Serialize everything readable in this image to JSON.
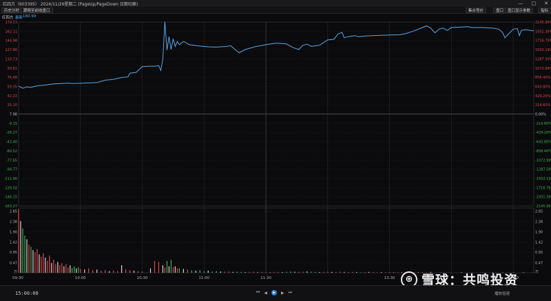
{
  "window": {
    "title": "红四方（603395） 2024/11/26星期二  (PageUp/PageDown 日期切换)",
    "minimize": "—",
    "maximize": "□",
    "close": "✕"
  },
  "toolbar": {
    "history_btn": "历史分时",
    "follow_btn": "跟随至前收盘口",
    "auction_btn": "集合竞价",
    "orderbook_btn": "盘口",
    "orderbook_params_btn": "盘口显示参数",
    "indicator_btn": "指标"
  },
  "info": {
    "stock_name": "红四方",
    "latest_label": "最新",
    "latest_value": "160.99"
  },
  "colors": {
    "up": "#e0484e",
    "down": "#3db24f",
    "line": "#5aa7e8",
    "grid": "#2a2a2e",
    "axis_text": "#b0b0b0"
  },
  "chart_data": [
    {
      "type": "line",
      "name": "price",
      "x_ticks": [
        "09:30",
        "10:00",
        "10:30",
        "11:00",
        "11:30",
        "13:30",
        "14:30"
      ],
      "price_levels": [
        "179.23",
        "162.11",
        "144.98",
        "127.86",
        "110.73",
        "93.61",
        "76.48",
        "59.35",
        "42.23",
        "25.10",
        "7.98",
        "-9.15",
        "-26.27",
        "-43.40",
        "-60.52",
        "-77.65",
        "-94.77",
        "-111.90",
        "-129.02",
        "-146.15",
        "-163.27"
      ],
      "pct_levels": [
        "2145.99%",
        "1931.39%",
        "1716.79%",
        "1502.19%",
        "1287.59%",
        "1072.99%",
        "858.40%",
        "643.80%",
        "429.20%",
        "214.60%",
        "0.00%",
        "-214.60%",
        "-429.20%",
        "-643.80%",
        "-858.40%",
        "-1072.99%",
        "-1287.59%",
        "-1502.19%",
        "-1716.79%",
        "-1931.39%",
        "-2145.99%"
      ],
      "ylim": [
        -163.27,
        179.23
      ],
      "prev_close": 7.98,
      "points": [
        [
          0,
          60.0
        ],
        [
          2,
          56.0
        ],
        [
          4,
          58.5
        ],
        [
          6,
          57.5
        ],
        [
          8,
          59.5
        ],
        [
          10,
          61.0
        ],
        [
          12,
          61.5
        ],
        [
          14,
          62.5
        ],
        [
          17,
          64.0
        ],
        [
          20,
          64.5
        ],
        [
          24,
          65.5
        ],
        [
          26,
          64.8
        ],
        [
          30,
          65.2
        ],
        [
          38,
          66.5
        ],
        [
          42,
          71.0
        ],
        [
          46,
          72.5
        ],
        [
          50,
          76.0
        ],
        [
          53,
          77.0
        ],
        [
          54,
          84.0
        ],
        [
          57,
          85.5
        ],
        [
          60,
          96.0
        ],
        [
          63,
          97.0
        ],
        [
          66,
          97.0
        ],
        [
          68,
          98.0
        ],
        [
          69,
          89.0
        ],
        [
          70,
          110.0
        ],
        [
          71,
          180.0
        ],
        [
          72,
          127.0
        ],
        [
          73,
          152.0
        ],
        [
          74,
          128.0
        ],
        [
          75,
          148.0
        ],
        [
          76,
          134.0
        ],
        [
          77,
          143.0
        ],
        [
          78,
          137.0
        ],
        [
          80,
          143.0
        ],
        [
          83,
          137.0
        ],
        [
          86,
          135.5
        ],
        [
          88,
          134.5
        ],
        [
          92,
          133.0
        ],
        [
          96,
          132.5
        ],
        [
          100,
          133.5
        ],
        [
          103,
          135.0
        ],
        [
          105,
          128.0
        ],
        [
          107,
          122.0
        ],
        [
          110,
          128.0
        ],
        [
          115,
          133.5
        ],
        [
          120,
          137.0
        ],
        [
          125,
          140.0
        ],
        [
          130,
          138.5
        ],
        [
          133,
          132.0
        ],
        [
          136,
          128.0
        ],
        [
          138,
          136.0
        ],
        [
          140,
          138.0
        ],
        [
          142,
          134.0
        ],
        [
          146,
          136.0
        ],
        [
          150,
          146.0
        ],
        [
          153,
          147.0
        ],
        [
          155,
          157.0
        ],
        [
          157,
          160.0
        ],
        [
          158,
          150.0
        ],
        [
          160,
          152.0
        ],
        [
          163,
          154.0
        ],
        [
          165,
          152.0
        ],
        [
          168,
          153.0
        ],
        [
          172,
          154.0
        ],
        [
          176,
          154.5
        ],
        [
          180,
          155.0
        ],
        [
          185,
          155.5
        ],
        [
          188,
          158.0
        ],
        [
          192,
          163.0
        ],
        [
          196,
          169.0
        ],
        [
          198,
          172.0
        ],
        [
          200,
          168.0
        ],
        [
          202,
          159.0
        ],
        [
          204,
          166.0
        ],
        [
          206,
          168.0
        ],
        [
          208,
          163.5
        ],
        [
          210,
          169.0
        ],
        [
          215,
          170.0
        ],
        [
          218,
          170.5
        ],
        [
          220,
          169.0
        ],
        [
          225,
          169.0
        ],
        [
          230,
          168.0
        ],
        [
          233,
          166.0
        ],
        [
          235,
          159.0
        ],
        [
          236,
          150.0
        ],
        [
          238,
          158.0
        ],
        [
          240,
          166.0
        ],
        [
          242,
          167.0
        ],
        [
          243,
          154.0
        ],
        [
          244,
          164.0
        ],
        [
          246,
          165.0
        ],
        [
          250,
          163.0
        ]
      ]
    },
    {
      "type": "bar",
      "name": "volume",
      "unit": "万",
      "y_ticks": [
        "2.85",
        "2.38",
        "1.90",
        "1.42",
        "0.95",
        "0.47"
      ],
      "ylim": [
        0,
        3.0
      ],
      "x": [
        0,
        1,
        2,
        3,
        4,
        5,
        6,
        7,
        8,
        9,
        10,
        11,
        12,
        13,
        14,
        15,
        16,
        17,
        18,
        19,
        20,
        21,
        22,
        23,
        24,
        25,
        26,
        27,
        28,
        29,
        30,
        32,
        34,
        36,
        38,
        40,
        42,
        44,
        46,
        48,
        50,
        52,
        54,
        56,
        58,
        60,
        64,
        66,
        68,
        70,
        71,
        72,
        73,
        74,
        75,
        76,
        77,
        78,
        80,
        82,
        84,
        86,
        88,
        90,
        92,
        94,
        96,
        98,
        100,
        102,
        104,
        106,
        108,
        110,
        112,
        114,
        116,
        118,
        120,
        122,
        124,
        126,
        128,
        130,
        132,
        134,
        136,
        138,
        140,
        142,
        144,
        146,
        148,
        150,
        152,
        154,
        156,
        158,
        160,
        162,
        164,
        166,
        168,
        170,
        172,
        174,
        176,
        178,
        180,
        182,
        184,
        186,
        188,
        190,
        192,
        194,
        196,
        198,
        200,
        205,
        210,
        215,
        220,
        225,
        230,
        235,
        240,
        245,
        250
      ],
      "values": [
        2.95,
        2.4,
        2.05,
        1.72,
        1.55,
        1.3,
        1.2,
        1.05,
        0.95,
        1.1,
        0.85,
        0.75,
        0.9,
        0.7,
        0.55,
        0.8,
        0.45,
        0.6,
        0.4,
        0.5,
        0.35,
        0.45,
        0.3,
        0.4,
        0.25,
        0.35,
        0.22,
        0.3,
        0.2,
        0.25,
        0.18,
        0.15,
        0.2,
        0.12,
        0.15,
        0.1,
        0.12,
        0.08,
        0.1,
        0.08,
        0.35,
        0.15,
        0.12,
        0.1,
        0.08,
        0.06,
        0.2,
        0.55,
        0.5,
        0.35,
        0.25,
        0.55,
        0.3,
        0.6,
        0.25,
        0.3,
        0.2,
        0.22,
        0.18,
        0.15,
        0.12,
        0.1,
        0.12,
        0.08,
        0.1,
        0.06,
        0.08,
        0.06,
        0.05,
        0.06,
        0.04,
        0.05,
        0.04,
        0.03,
        0.04,
        0.05,
        0.03,
        0.04,
        0.03,
        0.02,
        0.03,
        0.04,
        0.03,
        0.05,
        0.06,
        0.05,
        0.04,
        0.05,
        0.06,
        0.05,
        0.04,
        0.03,
        0.04,
        0.05,
        0.04,
        0.03,
        0.05,
        0.04,
        0.03,
        0.04,
        0.03,
        0.02,
        0.03,
        0.04,
        0.03,
        0.02,
        0.03,
        0.02,
        0.03,
        0.02,
        0.02,
        0.03,
        0.02,
        0.03,
        0.02,
        0.02,
        0.03,
        0.02,
        0.04,
        0.02,
        0.02,
        0.02,
        0.02,
        0.02,
        0.02,
        0.02,
        0.02,
        0.02,
        0.02
      ]
    }
  ],
  "bottom": {
    "time": "15:00:00",
    "speed_label": "播放倍速",
    "ctrl_first": "⏮",
    "ctrl_prev": "◀",
    "ctrl_play": "▶",
    "ctrl_next": "▶",
    "ctrl_last": "⏭"
  },
  "watermark": {
    "logo_char": "⊕",
    "text": "雪球：共鸣投资"
  }
}
